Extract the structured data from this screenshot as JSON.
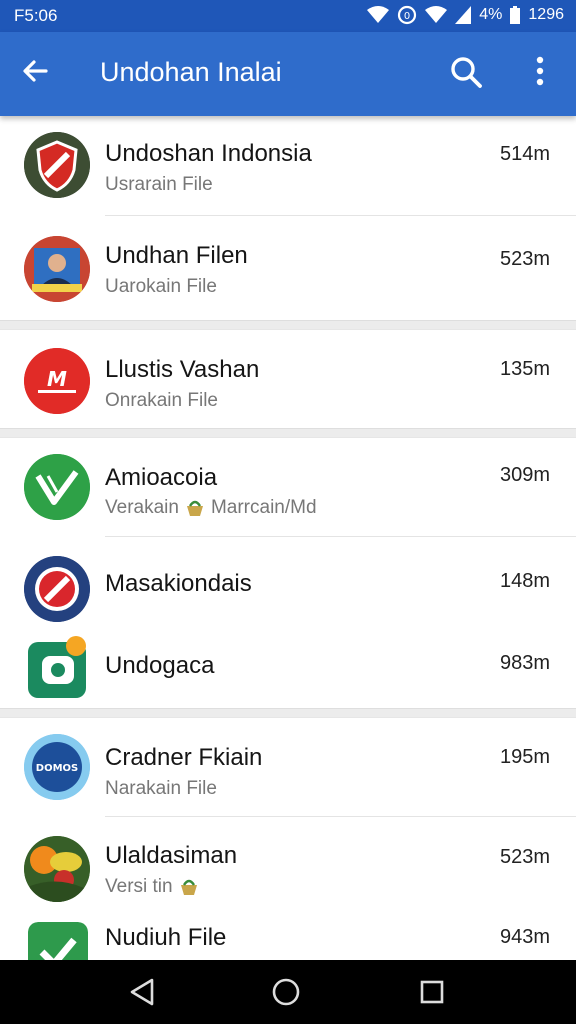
{
  "status_bar": {
    "time": "F5:06",
    "battery_percent": "4%",
    "right_text": "1296",
    "icons": [
      "wifi-icon",
      "data-saver-icon",
      "wifi-icon",
      "cell-signal-icon",
      "battery-icon"
    ]
  },
  "app_bar": {
    "title": "Undohan Inalai",
    "icons": [
      "back-arrow-icon",
      "search-icon",
      "more-vert-icon"
    ]
  },
  "items": [
    {
      "name": "Undoshan Indonsia",
      "subtitle": "Usrarain File",
      "size": "514m",
      "icon": "red-shield-app-icon"
    },
    {
      "name": "Undhan Filen",
      "subtitle": "Uarokain File",
      "size": "523m",
      "icon": "portrait-photo-icon"
    },
    {
      "name": "Llustis Vashan",
      "subtitle": "Onrakain File",
      "size": "135m",
      "icon": "red-m-logo-icon"
    },
    {
      "name": "Amioacoia",
      "subtitle": "Verakain",
      "subtitle_extra": "Marrcain/Md",
      "size": "309m",
      "icon": "green-v-check-icon"
    },
    {
      "name": "Masakiondais",
      "subtitle": "",
      "size": "148m",
      "icon": "navy-slash-circle-icon"
    },
    {
      "name": "Undogaca",
      "subtitle": "",
      "size": "983m",
      "icon": "green-square-app-icon"
    },
    {
      "name": "Cradner Fkiain",
      "subtitle": "Narakain File",
      "size": "195m",
      "icon": "blue-badge-logo-icon"
    },
    {
      "name": "Ulaldasiman",
      "subtitle": "Versi tin",
      "size": "523m",
      "icon": "fruit-photo-icon"
    },
    {
      "name": "Nudiuh File",
      "subtitle": "",
      "size": "943m",
      "icon": "green-puzzle-app-icon"
    }
  ],
  "badges": {
    "blue_logo_text": "DOMOS",
    "red_logo_letter": "M"
  },
  "colors": {
    "app_bar": "#2f6ccb",
    "status_bar": "#1f57b8",
    "nav_bar": "#000000"
  },
  "nav_bar": {
    "icons": [
      "back-triangle-icon",
      "home-circle-icon",
      "recents-square-icon"
    ]
  }
}
